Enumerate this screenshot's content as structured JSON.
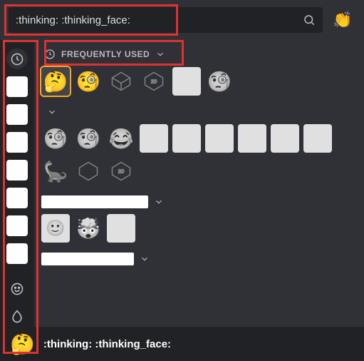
{
  "search": {
    "value": ":thinking: :thinking_face:",
    "placeholder": "Search"
  },
  "tone_emoji": "👏",
  "sections": {
    "frequent": {
      "label": "FREQUENTLY USED"
    }
  },
  "frequent_emoji": {
    "e0": "🤔",
    "e1": "🧐",
    "e5": "🧐"
  },
  "server1_emoji": {
    "e0": "🧐",
    "e1": "🧐",
    "e2": "😂"
  },
  "server1b_emoji": {
    "e0": "🦕"
  },
  "server2_emoji": {
    "e1": "🤯"
  },
  "preview": {
    "emoji": "🤔",
    "label": ":thinking: :thinking_face:"
  },
  "server_widths": {
    "s1": "80",
    "s2": "150",
    "s3": "130"
  }
}
